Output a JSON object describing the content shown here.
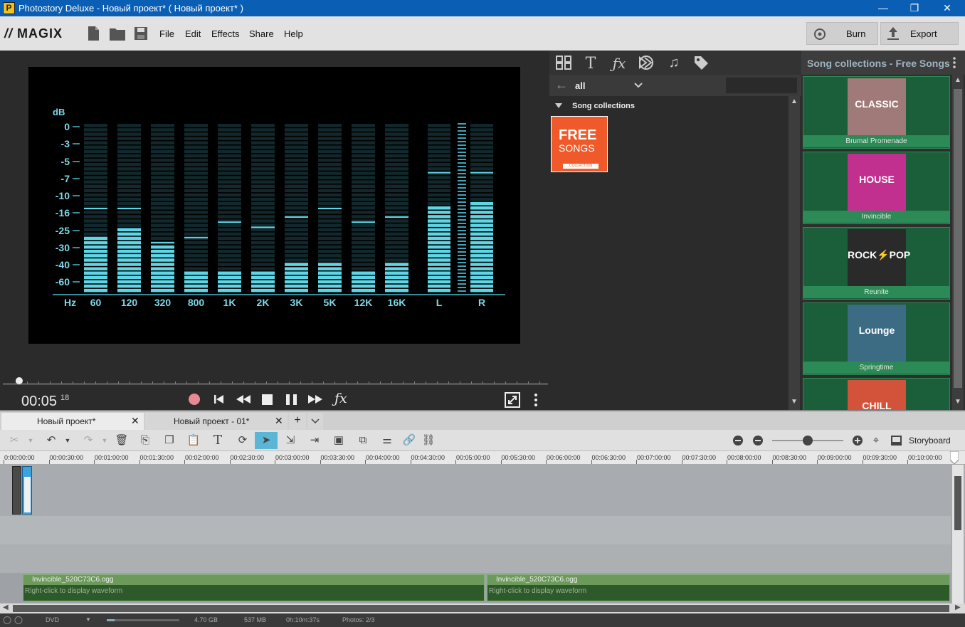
{
  "window": {
    "title": "Photostory Deluxe - Новый проект* ( Новый проект* )",
    "app_icon": "P",
    "controls": {
      "minimize": "—",
      "maximize": "❐",
      "close": "✕"
    }
  },
  "menubar": {
    "logo": "MAGIX",
    "menus": [
      "File",
      "Edit",
      "Effects",
      "Share",
      "Help"
    ],
    "burn_label": "Burn",
    "export_label": "Export"
  },
  "equalizer": {
    "db_label": "dB",
    "db_ticks": [
      "0",
      "-3",
      "-5",
      "-7",
      "-10",
      "-16",
      "-25",
      "-30",
      "-40",
      "-60"
    ],
    "hz_label": "Hz",
    "bands": [
      "60",
      "120",
      "320",
      "800",
      "1K",
      "2K",
      "3K",
      "5K",
      "12K",
      "16K"
    ],
    "band_levels": [
      0.34,
      0.41,
      0.29,
      0.15,
      0.15,
      0.15,
      0.18,
      0.2,
      0.15,
      0.18
    ],
    "band_peaks": [
      0.5,
      0.5,
      0.3,
      0.33,
      0.42,
      0.39,
      0.45,
      0.5,
      0.42,
      0.45
    ],
    "channels": [
      "L",
      "R"
    ],
    "channel_levels": [
      0.52,
      0.55
    ],
    "channel_peaks": [
      0.71,
      0.71
    ]
  },
  "transport": {
    "time_main": "00:05",
    "time_frames": "18",
    "scrub_position": 0.03,
    "buttons": [
      "record",
      "to-start",
      "rewind",
      "stop",
      "pause",
      "fast-forward",
      "effects"
    ]
  },
  "pool": {
    "tabs": [
      "grid",
      "text",
      "fx",
      "transition",
      "music",
      "tag"
    ],
    "filter_value": "all",
    "section_title": "Song collections",
    "item": {
      "line1": "FREE",
      "line2": "SONGS",
      "sub": "COLLECTION"
    }
  },
  "songs": {
    "header": "Song collections - Free Songs",
    "tiles": [
      {
        "cover": "CLASSIC",
        "label": "Brumal Promenade",
        "color": "#a07a78"
      },
      {
        "cover": "HOUSE",
        "label": "Invincible",
        "color": "#c2308f"
      },
      {
        "cover": "ROCK⚡POP",
        "label": "Reunite",
        "color": "#2a2a2a"
      },
      {
        "cover": "Lounge",
        "label": "Springtime",
        "color": "#3c6c84"
      },
      {
        "cover": "CHILL",
        "label": "",
        "color": "#d2523a"
      }
    ]
  },
  "project_tabs": [
    {
      "label": "Новый проект*",
      "active": true
    },
    {
      "label": "Новый проект - 01*",
      "active": false
    }
  ],
  "timeline_toolbar": {
    "storyboard_label": "Storyboard",
    "zoom_level": 0.5
  },
  "ruler": {
    "ticks": [
      "0:00:00:00",
      "00:00:30:00",
      "00:01:00:00",
      "00:01:30:00",
      "00:02:00:00",
      "00:02:30:00",
      "00:03:00:00",
      "00:03:30:00",
      "00:04:00:00",
      "00:04:30:00",
      "00:05:00:00",
      "00:05:30:00",
      "00:06:00:00",
      "00:06:30:00",
      "00:07:00:00",
      "00:07:30:00",
      "00:08:00:00",
      "00:08:30:00",
      "00:09:00:00",
      "00:09:30:00",
      "00:10:00:00"
    ]
  },
  "audio_clips": [
    {
      "name": "Invincible_520C73C6.ogg",
      "hint": "Right-click to display waveform"
    },
    {
      "name": "Invincible_520C73C6.ogg",
      "hint": "Right-click to display waveform"
    }
  ],
  "status": {
    "disc": "DVD",
    "capacity": "4.70 GB",
    "used": "537 MB",
    "duration": "0h:10m:37s",
    "photos": "Photos: 2/3"
  }
}
